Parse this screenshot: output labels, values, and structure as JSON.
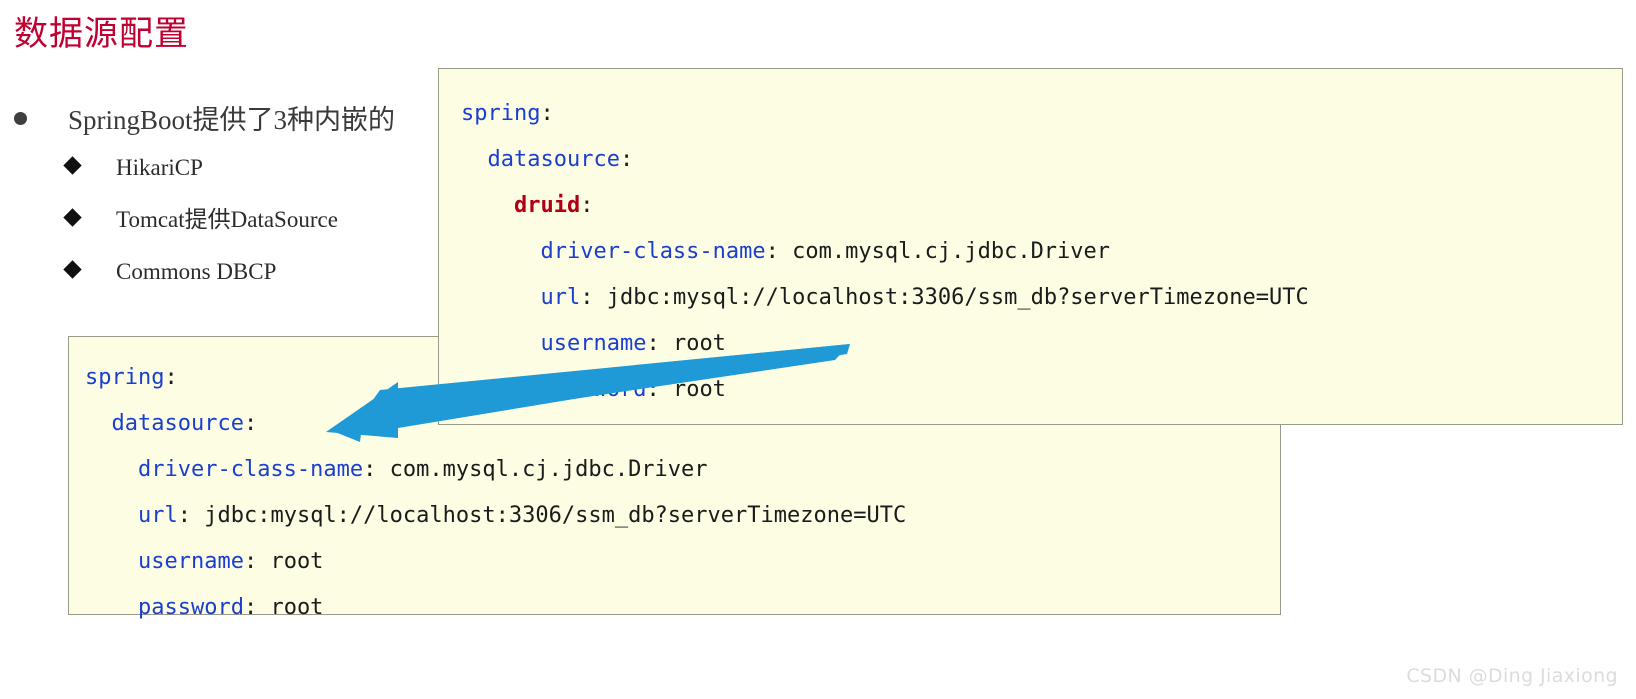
{
  "slide": {
    "title": "数据源配置",
    "title_color": "#c00030",
    "watermark": "CSDN @Ding Jiaxiong"
  },
  "bullets": [
    {
      "level": 1,
      "marker": "disc-bullet-icon",
      "text": "SpringBoot提供了3种内嵌的"
    },
    {
      "level": 2,
      "marker": "diamond-bullet-icon",
      "text": "HikariCP"
    },
    {
      "level": 2,
      "marker": "diamond-bullet-icon",
      "text": "Tomcat提供DataSource"
    },
    {
      "level": 2,
      "marker": "diamond-bullet-icon",
      "text": "Commons DBCP"
    }
  ],
  "code_primary": {
    "name": "druid-datasource-yaml",
    "background": "#fdfde4",
    "border": "#9a9a8c",
    "key_color": "#1a3fcf",
    "highlight_color": "#b00014",
    "lines": [
      {
        "indent": 0,
        "key": "spring",
        "highlight": false,
        "value": ""
      },
      {
        "indent": 1,
        "key": "datasource",
        "highlight": false,
        "value": ""
      },
      {
        "indent": 2,
        "key": "druid",
        "highlight": true,
        "value": ""
      },
      {
        "indent": 3,
        "key": "driver-class-name",
        "highlight": false,
        "value": " com.mysql.cj.jdbc.Driver"
      },
      {
        "indent": 3,
        "key": "url",
        "highlight": false,
        "value": " jdbc:mysql://localhost:3306/ssm_db?serverTimezone=UTC"
      },
      {
        "indent": 3,
        "key": "username",
        "highlight": false,
        "value": " root"
      },
      {
        "indent": 3,
        "key": "password",
        "highlight": false,
        "value": " root"
      }
    ]
  },
  "code_secondary": {
    "name": "default-datasource-yaml",
    "background": "#fdfde4",
    "border": "#9a9a8c",
    "key_color": "#1a3fcf",
    "lines": [
      {
        "indent": 0,
        "key": "spring",
        "highlight": false,
        "value": ""
      },
      {
        "indent": 1,
        "key": "datasource",
        "highlight": false,
        "value": ""
      },
      {
        "indent": 2,
        "key": "driver-class-name",
        "highlight": false,
        "value": " com.mysql.cj.jdbc.Driver"
      },
      {
        "indent": 2,
        "key": "url",
        "highlight": false,
        "value": " jdbc:mysql://localhost:3306/ssm_db?serverTimezone=UTC"
      },
      {
        "indent": 2,
        "key": "username",
        "highlight": false,
        "value": " root"
      },
      {
        "indent": 2,
        "key": "password",
        "highlight": false,
        "value": " root"
      }
    ]
  },
  "annotation": {
    "arrow_color": "#1f9ad6",
    "direction": "points-left-down",
    "from": "druid-datasource-yaml",
    "to": "default-datasource-yaml"
  }
}
